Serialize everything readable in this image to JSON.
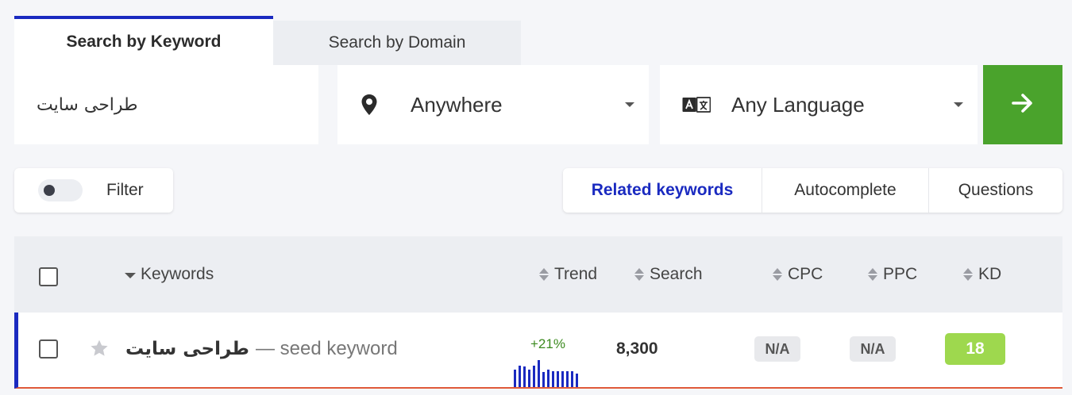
{
  "tabs": {
    "keyword": "Search by Keyword",
    "domain": "Search by Domain"
  },
  "search": {
    "keyword_value": "طراحی سایت",
    "location": "Anywhere",
    "language": "Any Language",
    "location_icon": "map-pin-icon",
    "language_icon": "translate-icon",
    "go_icon": "arrow-right-icon"
  },
  "filter": {
    "label": "Filter",
    "enabled": false
  },
  "result_tabs": [
    "Related keywords",
    "Autocomplete",
    "Questions"
  ],
  "table": {
    "columns": {
      "keywords": "Keywords",
      "trend": "Trend",
      "search": "Search",
      "cpc": "CPC",
      "ppc": "PPC",
      "kd": "KD"
    },
    "rows": [
      {
        "keyword": "طراحی سایت",
        "note": "— seed keyword",
        "trend_change": "+21%",
        "trend_values": [
          0.65,
          0.8,
          0.75,
          0.65,
          0.8,
          1.0,
          0.55,
          0.65,
          0.6,
          0.6,
          0.6,
          0.6,
          0.6,
          0.5
        ],
        "search": "8,300",
        "cpc": "N/A",
        "ppc": "N/A",
        "kd": "18"
      }
    ]
  },
  "colors": {
    "accent": "#1a2ac0",
    "go_button": "#4aa32c",
    "kd_badge": "#9ed84e",
    "trend_positive": "#3c8a1f"
  }
}
